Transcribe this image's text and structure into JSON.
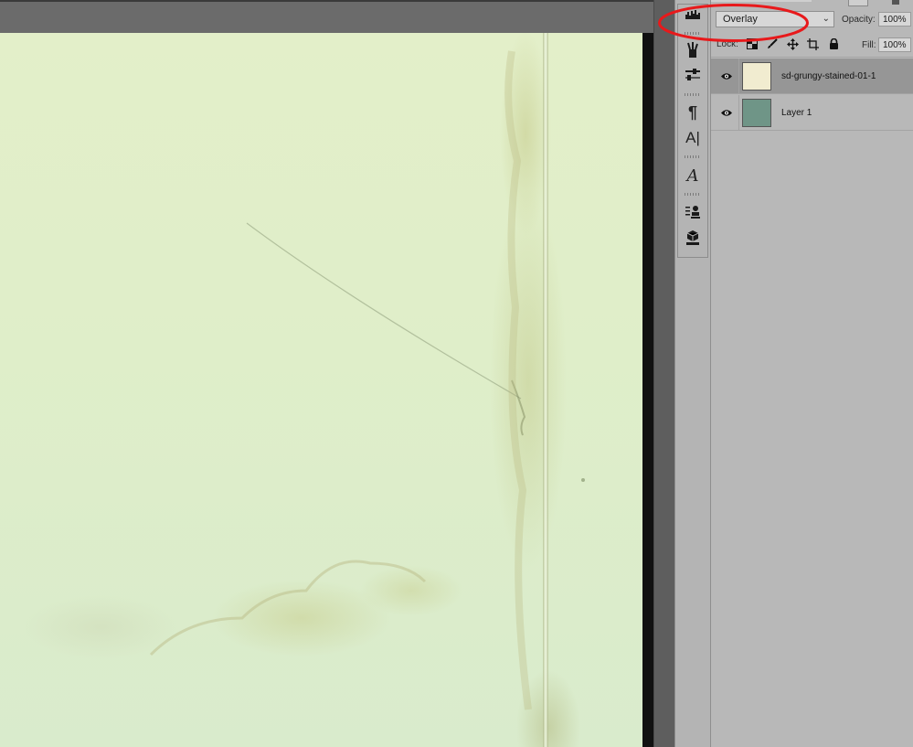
{
  "layers_panel": {
    "blend_mode": "Overlay",
    "opacity_label": "Opacity:",
    "opacity_value": "100%",
    "lock_label": "Lock:",
    "fill_label": "Fill:",
    "fill_value": "100%",
    "layers": [
      {
        "name": "sd-grungy-stained-01-1",
        "visible": true,
        "selected": true,
        "thumb_color": "#f1ecd0"
      },
      {
        "name": "Layer 1",
        "visible": true,
        "selected": false,
        "thumb_color": "#6f9587"
      }
    ]
  },
  "icon_dock": {
    "icons": [
      "histogram-icon",
      "brushes-icon",
      "adjustments-icon",
      "paragraph-icon",
      "character-icon",
      "glyphs-icon",
      "clone-source-icon",
      "3d-icon"
    ]
  },
  "annotation": {
    "shape": "red-ellipse",
    "color": "#e8191b",
    "target": "blend-mode-select"
  },
  "colors": {
    "canvas": "#dfeec9",
    "panel": "#b8b8b8",
    "selected_layer": "#969696",
    "workspace": "#6a6a6a"
  }
}
